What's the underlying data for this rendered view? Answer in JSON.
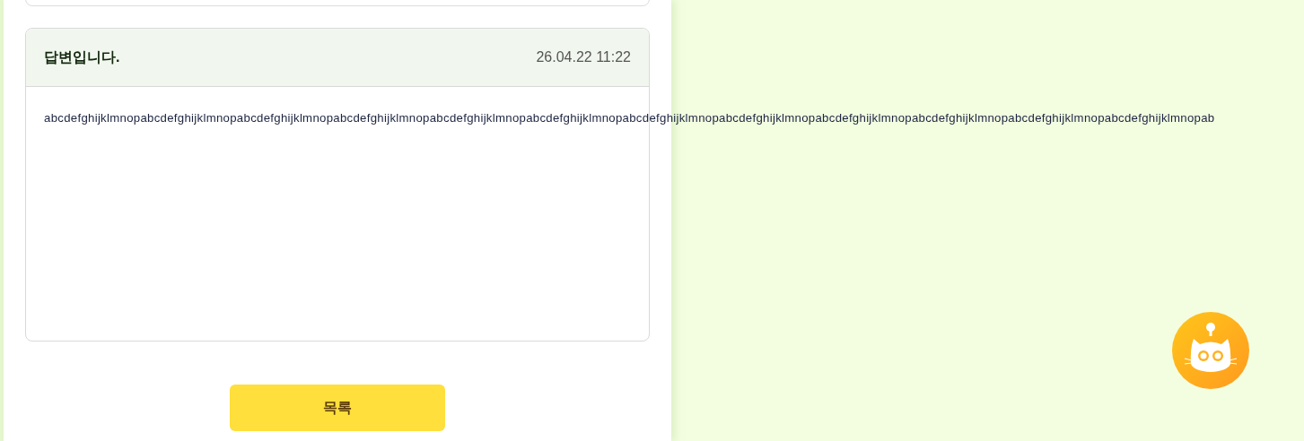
{
  "answer": {
    "title": "답변입니다.",
    "date": "26.04.22 11:22",
    "body": "abcdefghijklmnopabcdefghijklmnopabcdefghijklmnopabcdefghijklmnopabcdefghijklmnopabcdefghijklmnopabcdefghijklmnopabcdefghijklmnopabcdefghijklmnopabcdefghijklmnopabcdefghijklmnopabcdefghijklmnopab"
  },
  "list_button": {
    "label": "목록"
  }
}
